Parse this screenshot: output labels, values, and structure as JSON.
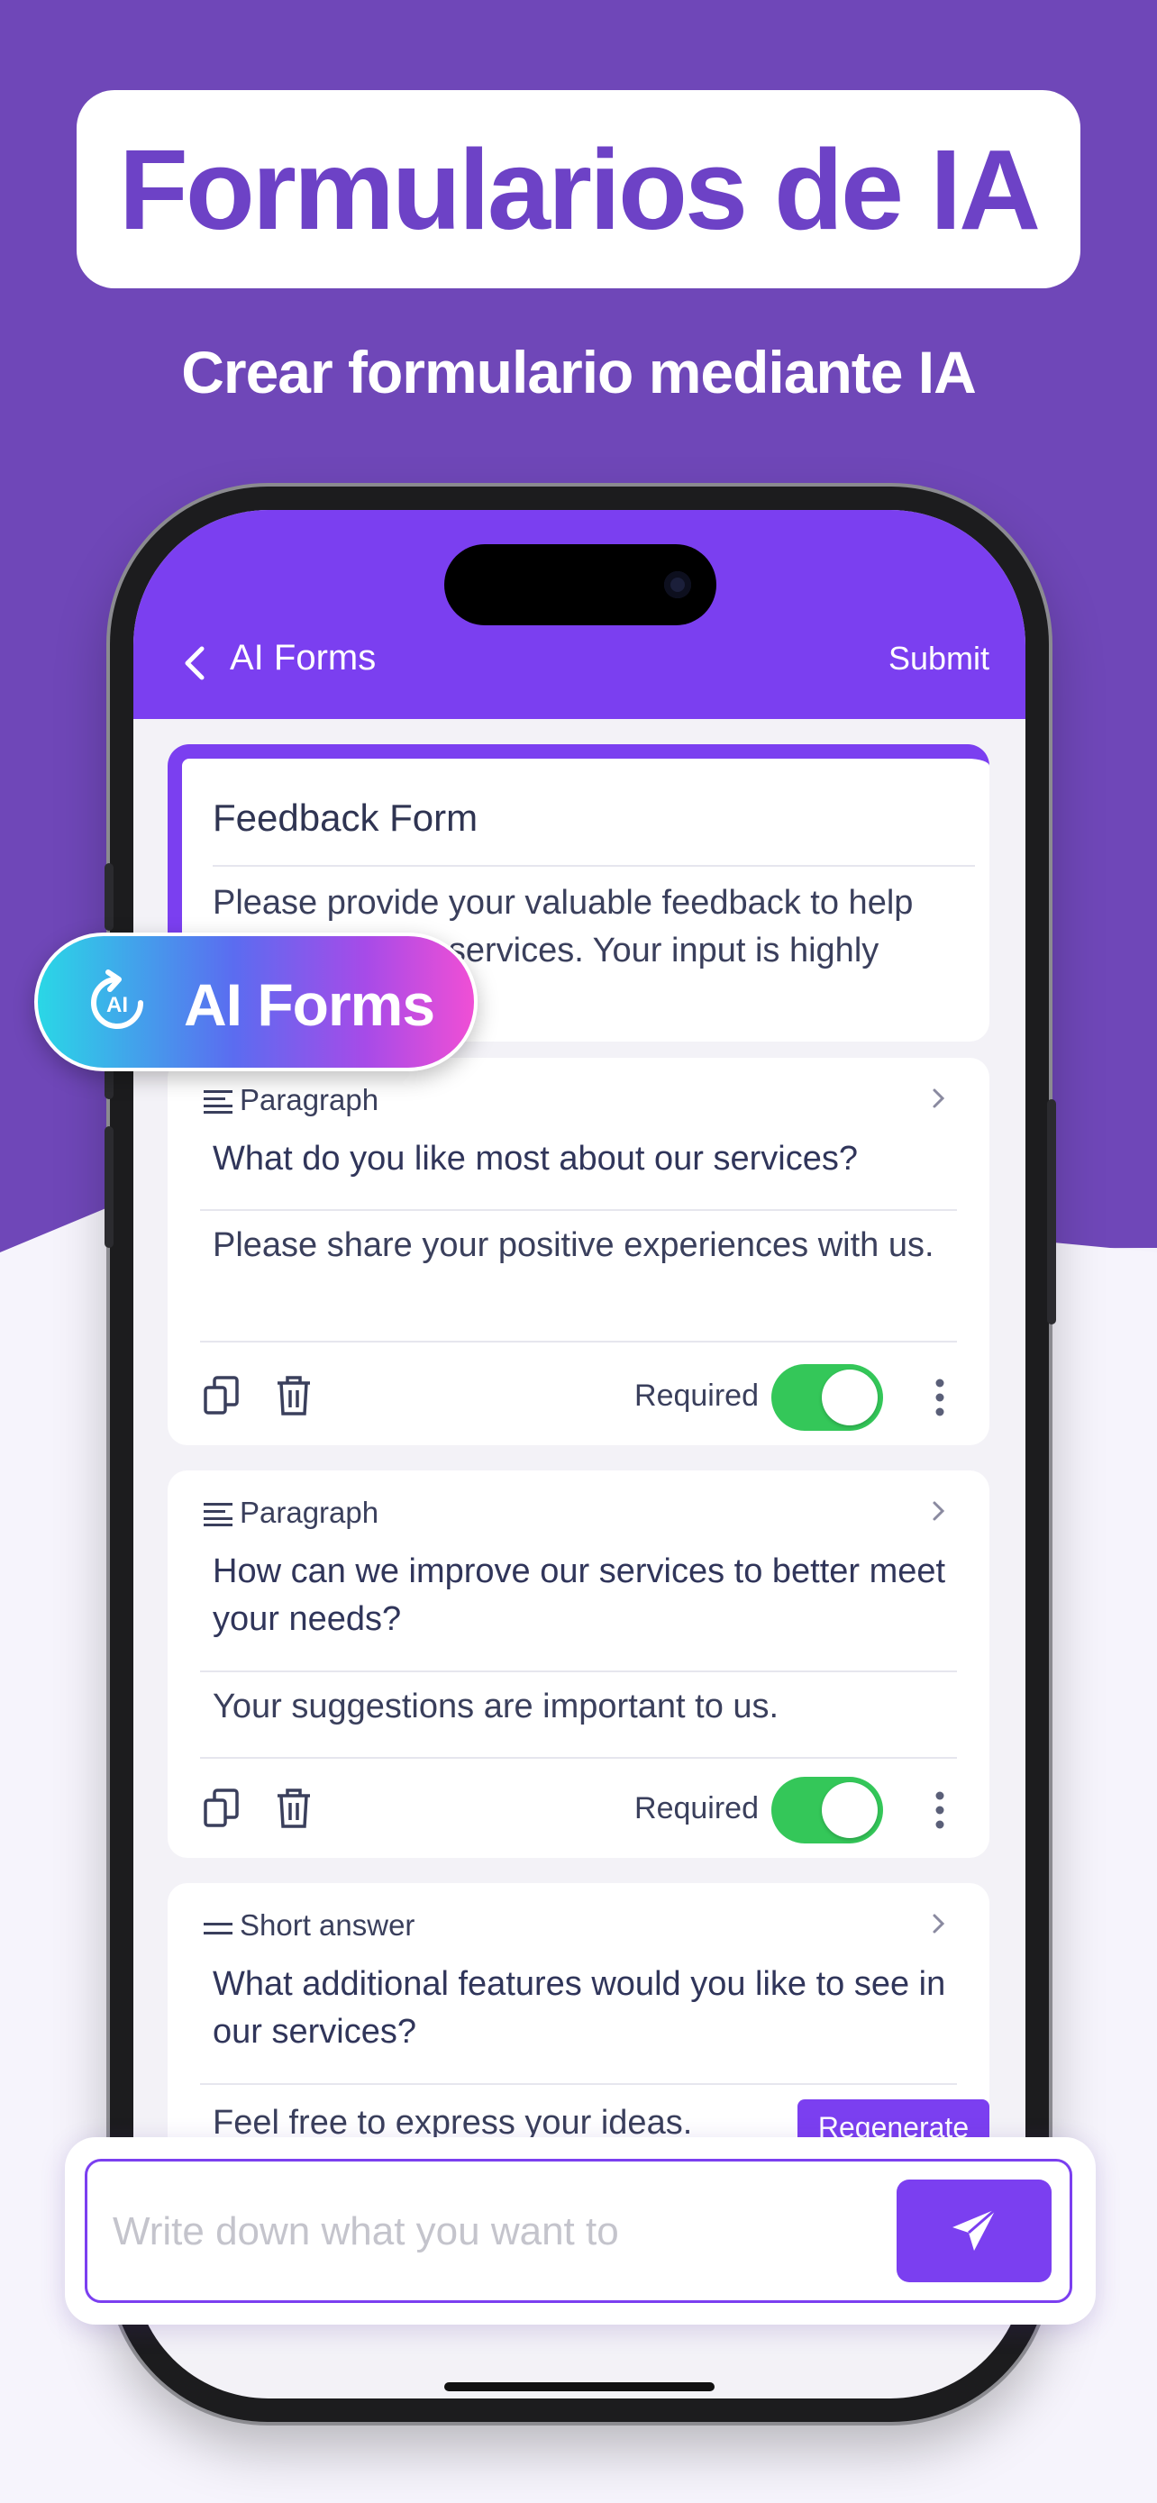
{
  "banner": {
    "title": "Formularios de IA",
    "subtitle": "Crear formulario mediante IA"
  },
  "app": {
    "nav_title": "AI Forms",
    "submit_label": "Submit",
    "accent_color": "#7b3ff0"
  },
  "form": {
    "title": "Feedback Form",
    "description": "Please provide your valuable feedback to help us improve our services. Your input is highly appreciated!"
  },
  "questions": [
    {
      "type": "Paragraph",
      "question": "What do you like most about our services?",
      "hint": "Please share your positive experiences with us.",
      "required_label": "Required",
      "required": true
    },
    {
      "type": "Paragraph",
      "question": "How can we improve our services to better meet your needs?",
      "hint": "Your suggestions are important to us.",
      "required_label": "Required",
      "required": true
    },
    {
      "type": "Short answer",
      "question": "What additional features would you like to see in our services?",
      "hint": "Feel free to express your ideas."
    }
  ],
  "regenerate_label": "Regenerate",
  "prompt": {
    "placeholder": "Write down what you want to"
  },
  "badge": {
    "label": "AI Forms",
    "icon_text": "AI"
  }
}
